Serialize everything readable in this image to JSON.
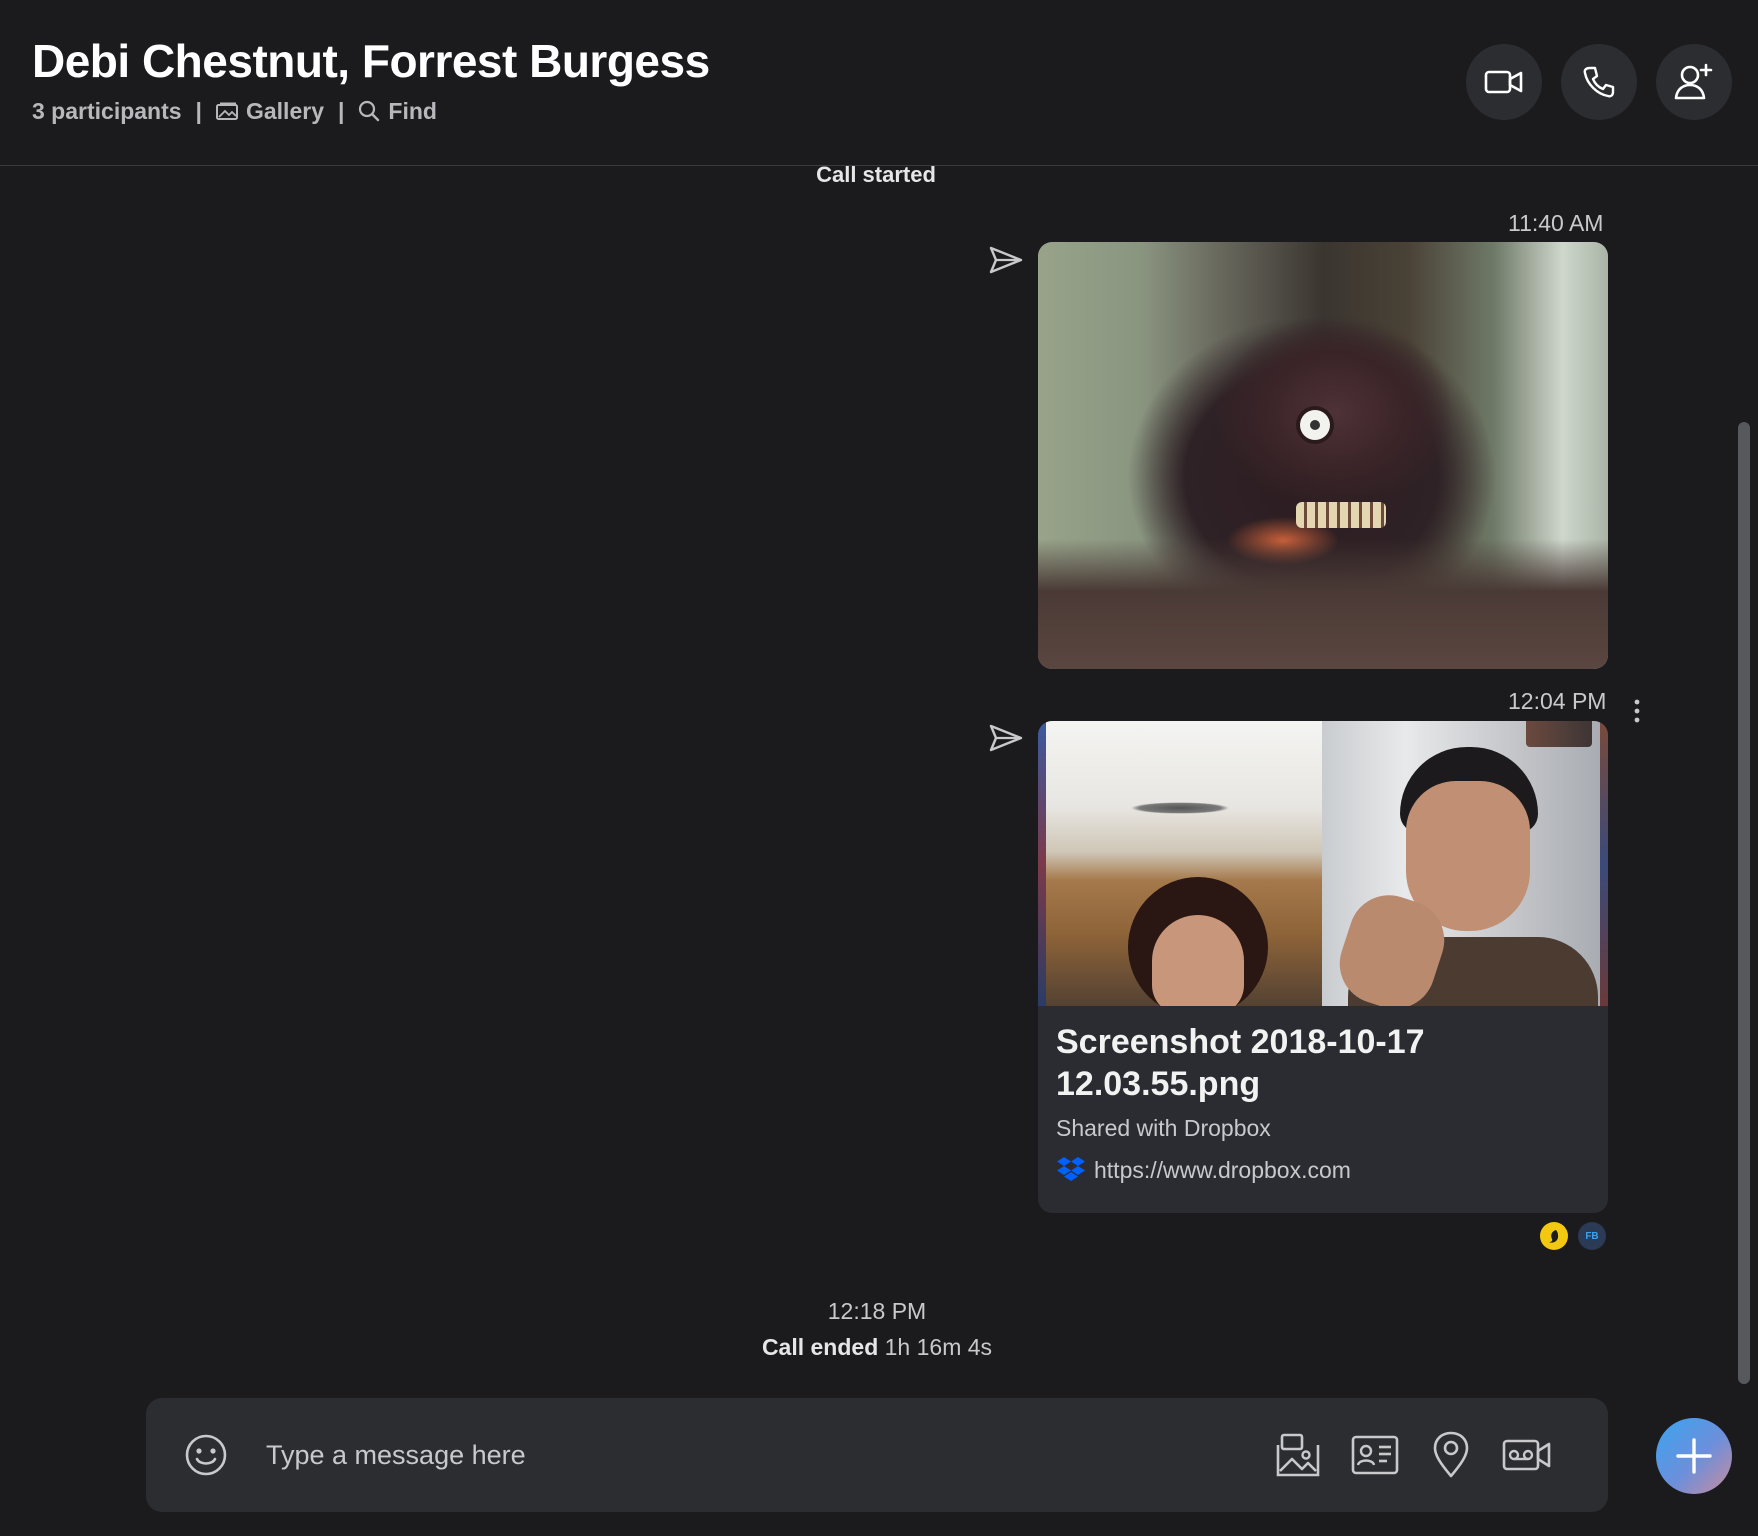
{
  "header": {
    "title": "Debi Chestnut, Forrest Burgess",
    "participants": "3 participants",
    "separator": "|",
    "gallery_label": "Gallery",
    "find_label": "Find"
  },
  "chat": {
    "call_started_label": "Call started",
    "messages": [
      {
        "time": "11:40 AM",
        "type": "image"
      },
      {
        "time": "12:04 PM",
        "type": "link-card",
        "file_name": "Screenshot 2018-10-17 12.03.55.png",
        "shared_text": "Shared with Dropbox",
        "url": "https://www.dropbox.com",
        "read_by": [
          {
            "initials": "",
            "color": "#f2c811"
          },
          {
            "initials": "FB",
            "color": "#2b3a55"
          }
        ]
      }
    ],
    "call_end": {
      "time": "12:18 PM",
      "label": "Call ended",
      "duration": "1h 16m 4s"
    }
  },
  "composer": {
    "placeholder": "Type a message here"
  },
  "colors": {
    "background": "#1b1b1e",
    "surface": "#2c2d31",
    "accent": "#39a4f0",
    "dropbox": "#0061fe"
  }
}
